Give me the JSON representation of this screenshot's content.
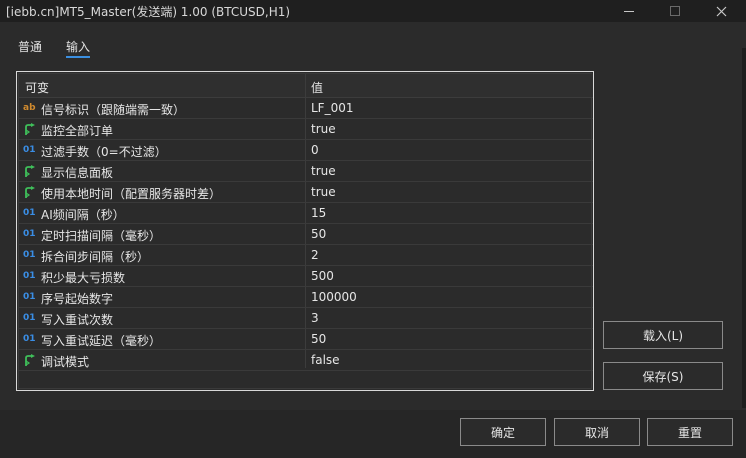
{
  "window": {
    "title": "[iebb.cn]MT5_Master(发送端) 1.00 (BTCUSD,H1)"
  },
  "tabs": [
    {
      "label": "普通"
    },
    {
      "label": "输入"
    }
  ],
  "table": {
    "headers": {
      "variable": "可变",
      "value": "值"
    },
    "rows": [
      {
        "icon": "ab",
        "name": "信号标识（跟随端需一致）",
        "value": "LF_001"
      },
      {
        "icon": "bool",
        "name": "监控全部订单",
        "value": "true"
      },
      {
        "icon": "01",
        "name": "过滤手数（0=不过滤）",
        "value": "0"
      },
      {
        "icon": "bool",
        "name": "显示信息面板",
        "value": "true"
      },
      {
        "icon": "bool",
        "name": "使用本地时间（配置服务器时差）",
        "value": "true"
      },
      {
        "icon": "01",
        "name": "AI频间隔（秒）",
        "value": "15"
      },
      {
        "icon": "01",
        "name": "定时扫描间隔（毫秒）",
        "value": "50"
      },
      {
        "icon": "01",
        "name": "拆合间步间隔（秒）",
        "value": "2"
      },
      {
        "icon": "01",
        "name": "积少最大亏损数",
        "value": "500"
      },
      {
        "icon": "01",
        "name": "序号起始数字",
        "value": "100000"
      },
      {
        "icon": "01",
        "name": "写入重试次数",
        "value": "3"
      },
      {
        "icon": "01",
        "name": "写入重试延迟（毫秒）",
        "value": "50"
      },
      {
        "icon": "bool",
        "name": "调试模式",
        "value": "false"
      }
    ]
  },
  "buttons": {
    "load": "载入(L)",
    "save": "保存(S)",
    "ok": "确定",
    "cancel": "取消",
    "reset": "重置"
  },
  "colors": {
    "accent": "#3b8fe0",
    "string_icon": "#d08a2e",
    "number_icon": "#3a8ee6",
    "bool_icon": "#3fbf5a"
  }
}
